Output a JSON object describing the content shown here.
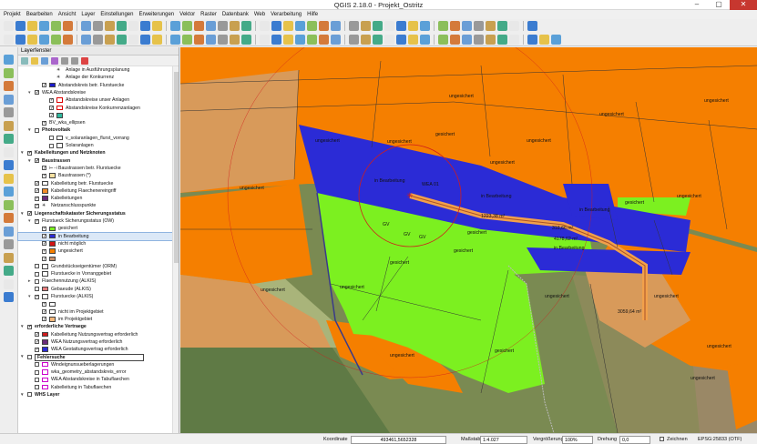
{
  "window": {
    "title": "QGIS 2.18.0 - Projekt_Ostritz"
  },
  "menu": [
    "Projekt",
    "Bearbeiten",
    "Ansicht",
    "Layer",
    "Einstellungen",
    "Erweiterungen",
    "Vektor",
    "Raster",
    "Datenbank",
    "Web",
    "Verarbeitung",
    "Hilfe"
  ],
  "panel": {
    "title": "Layerfenster",
    "rows": [
      {
        "label": "Anlage in Ausführungsplanung",
        "indent": 5,
        "cb": null,
        "swatch": null,
        "icon": "sym"
      },
      {
        "label": "Anlage der Konkurrenz",
        "indent": 5,
        "cb": null,
        "swatch": null,
        "icon": "sym"
      },
      {
        "label": "Abstandskreis betr. Flurstuecke",
        "indent": 3,
        "cb": true,
        "swatch": "#1a1acc"
      },
      {
        "label": "WEA Abstandskreise",
        "indent": 2,
        "cb": true,
        "swatch": null,
        "arrow": "▾"
      },
      {
        "label": "Abstandskreise unser Anlagen",
        "indent": 4,
        "cb": true,
        "swatch": "#ffffff",
        "border": "#d00"
      },
      {
        "label": "Abstandskreise Konkurrenzanlagen",
        "indent": 4,
        "cb": true,
        "swatch": "#ffffff",
        "border": "#d00"
      },
      {
        "label": "",
        "indent": 4,
        "cb": true,
        "swatch": "#2fb89e"
      },
      {
        "label": "BV_wka_ellipsen",
        "indent": 3,
        "cb": true,
        "swatch": null
      },
      {
        "label": "Photovoltaik",
        "indent": 2,
        "cb": false,
        "bold": true,
        "arrow": "▾"
      },
      {
        "label": "v_solaranlagen_flurst_vorrang",
        "indent": 4,
        "cb": false,
        "swatch": "#ffffff"
      },
      {
        "label": "Solaranlagen",
        "indent": 4,
        "cb": false,
        "swatch": "#ffffff"
      },
      {
        "label": "Kabelleitungen und Netzknoten",
        "indent": 1,
        "cb": true,
        "bold": true,
        "arrow": "▾"
      },
      {
        "label": "Baustrassen",
        "indent": 2,
        "cb": true,
        "bold": true,
        "arrow": "▾"
      },
      {
        "label": "Baustrassen betr. Flurstuecke",
        "indent": 3,
        "cb": true,
        "swatch": null,
        "icon": "line"
      },
      {
        "label": "Baustrassen (*)",
        "indent": 3,
        "cb": true,
        "swatch": "#f5e0a0"
      },
      {
        "label": "Kabelleitung betr. Flurstuecke",
        "indent": 2,
        "cb": true,
        "swatch": "#ffffff"
      },
      {
        "label": "Kabelleitung Flaechenereingriff",
        "indent": 2,
        "cb": true,
        "swatch": "#f28c28"
      },
      {
        "label": "Kabelleitungen",
        "indent": 2,
        "cb": true,
        "swatch": "#6a2c7a"
      },
      {
        "label": "Netzanschlusspunkte",
        "indent": 2,
        "cb": true,
        "swatch": null,
        "icon": "sym"
      },
      {
        "label": "Liegenschaftskataster Sicherungsstatus",
        "indent": 1,
        "cb": true,
        "bold": true,
        "arrow": "▾"
      },
      {
        "label": "Flurstueck Sicherungsstatus (OW)",
        "indent": 2,
        "cb": true,
        "swatch": null,
        "arrow": "▾"
      },
      {
        "label": "gesichert",
        "indent": 3,
        "cb": true,
        "swatch": "#7cf020"
      },
      {
        "label": "in Bearbeitung",
        "indent": 3,
        "cb": true,
        "swatch": "#2b2bd6",
        "sel": true
      },
      {
        "label": "nicht möglich",
        "indent": 3,
        "cb": true,
        "swatch": "#d21414"
      },
      {
        "label": "ungesichert",
        "indent": 3,
        "cb": true,
        "swatch": "#f57f00"
      },
      {
        "label": "",
        "indent": 3,
        "cb": true,
        "swatch": "#c8906a"
      },
      {
        "label": "Grundstückseigentümer (ORM)",
        "indent": 2,
        "cb": false,
        "swatch": "#ffffff"
      },
      {
        "label": "Flurstuecke in Vorranggebiet",
        "indent": 2,
        "cb": false,
        "swatch": "#ffffff"
      },
      {
        "label": "Flaechennutzung (ALKIS)",
        "indent": 2,
        "cb": false,
        "swatch": null,
        "arrow": "▸"
      },
      {
        "label": "Gebaeude (ALKIS)",
        "indent": 2,
        "cb": false,
        "swatch": "#e87f7f"
      },
      {
        "label": "Flurstuecke (ALKIS)",
        "indent": 2,
        "cb": true,
        "swatch": "#ffffff",
        "arrow": "▾"
      },
      {
        "label": "",
        "indent": 3,
        "cb": true,
        "swatch": "#ffffff"
      },
      {
        "label": "nicht im Projektgebiet",
        "indent": 3,
        "cb": true,
        "swatch": "#ffffff"
      },
      {
        "label": "im Projektgebiet",
        "indent": 3,
        "cb": true,
        "swatch": "#f5b87a"
      },
      {
        "label": "erforderliche Vertraege",
        "indent": 1,
        "cb": true,
        "bold": true,
        "arrow": "▾"
      },
      {
        "label": "Kabelleitung Nutzungsvertrag erforderlich",
        "indent": 2,
        "cb": true,
        "swatch": "#d01c1c"
      },
      {
        "label": "WEA Nutzungsvertrag erforderlich",
        "indent": 2,
        "cb": true,
        "swatch": "#6a2c7a"
      },
      {
        "label": "WEA Gestattungsvertrag erforderlich",
        "indent": 2,
        "cb": true,
        "swatch": "#2b2bd6"
      },
      {
        "label": "Fehlersuche",
        "indent": 1,
        "cb": false,
        "bold": true,
        "arrow": "▾",
        "boxed": true
      },
      {
        "label": "Windeignunsueberlagerungen",
        "indent": 2,
        "cb": false,
        "swatch": "#ffffff",
        "border": "#c0c"
      },
      {
        "label": "wka_geometry_abstandskreis_error",
        "indent": 2,
        "cb": false,
        "swatch": "#ffffff",
        "border": "#c0c"
      },
      {
        "label": "WEA Abstandskreise in Tabuflaechen",
        "indent": 2,
        "cb": false,
        "swatch": "#ffffff",
        "border": "#c0c"
      },
      {
        "label": "Kabelleitung in Tabuflaechen",
        "indent": 2,
        "cb": false,
        "swatch": "#ffffff",
        "border": "#c0c"
      },
      {
        "label": "WHS Layer",
        "indent": 1,
        "cb": false,
        "bold": true,
        "arrow": "▾"
      }
    ]
  },
  "map": {
    "labels": {
      "ungesichert": "ungesichert",
      "gesichert": "gesichert",
      "in_bearbeitung": "in Bearbeitung",
      "gv": "GV",
      "wea": "WEA 01",
      "m1": "1223,38 m²",
      "m2": "318,66 m²",
      "m3": "4178,62 m²",
      "m4": "3059,64 m²",
      "road1": "K 8614",
      "road2": "K 8614"
    }
  },
  "status": {
    "coord_label": "Koordinate",
    "coord_value": "493461,5652328",
    "scale_label": "Maßstab",
    "scale_value": "1:4.027",
    "mag_label": "Vergrößerung",
    "mag_value": "100%",
    "rot_label": "Drehung",
    "rot_value": "0,0",
    "render_label": "Zeichnen",
    "crs": "EPSG:25833 (OTF)"
  }
}
